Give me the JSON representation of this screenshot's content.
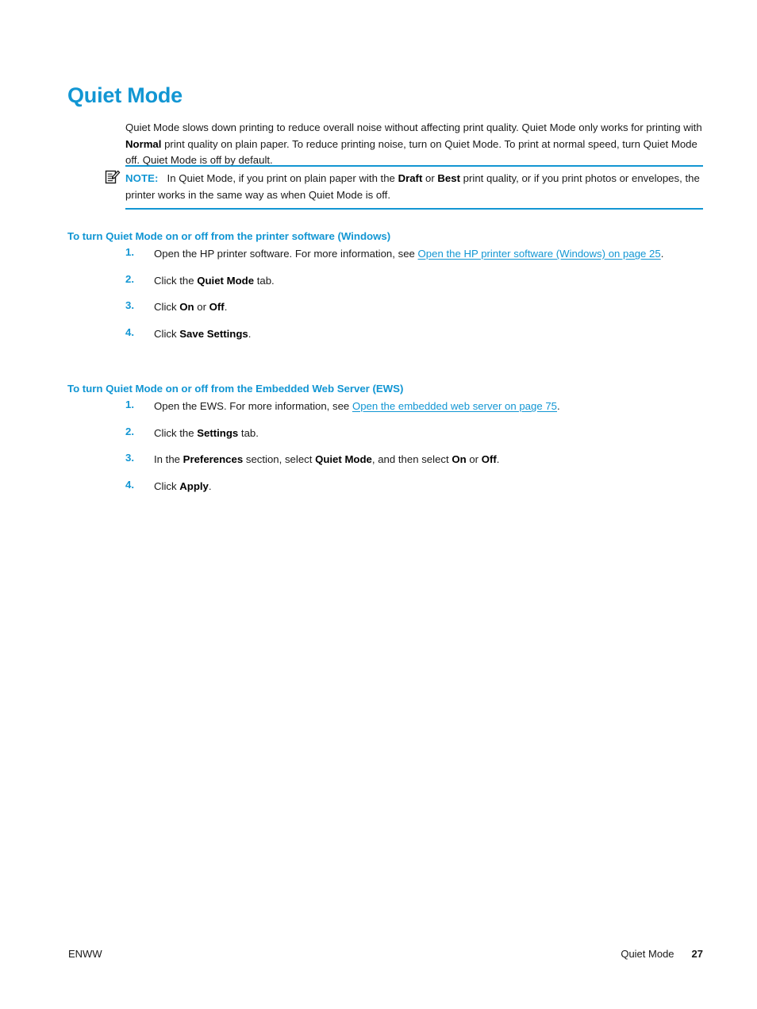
{
  "document": {
    "title": "Quiet Mode",
    "accent_color": "#1296d3",
    "body_color": "#1a1a1a"
  },
  "intro": {
    "part1": "Quiet Mode slows down printing to reduce overall noise without affecting print quality. Quiet Mode only works for printing with ",
    "bold1": "Normal",
    "part2": " print quality on plain paper. To reduce printing noise, turn on Quiet Mode. To print at normal speed, turn Quiet Mode off. Quiet Mode is off by default."
  },
  "note": {
    "icon": "note-pencil-icon",
    "label": "NOTE:",
    "part1": "In Quiet Mode, if you print on plain paper with the ",
    "bold1": "Draft",
    "part2": " or ",
    "bold2": "Best",
    "part3": " print quality, or if you print photos or envelopes, the printer works in the same way as when Quiet Mode is off."
  },
  "section_windows": {
    "heading": "To turn Quiet Mode on or off from the printer software (Windows)",
    "steps": [
      {
        "number": "1.",
        "part1": "Open the HP printer software. For more information, see ",
        "link": "Open the HP printer software (Windows) on page 25",
        "part2": "."
      },
      {
        "number": "2.",
        "part1": "Click the ",
        "bold1": "Quiet Mode",
        "part2": " tab."
      },
      {
        "number": "3.",
        "part1": "Click ",
        "bold1": "On",
        "part2": " or ",
        "bold2": "Off",
        "part3": "."
      },
      {
        "number": "4.",
        "part1": "Click ",
        "bold1": "Save Settings",
        "part2": "."
      }
    ]
  },
  "section_ews": {
    "heading": "To turn Quiet Mode on or off from the Embedded Web Server (EWS)",
    "steps": [
      {
        "number": "1.",
        "part1": "Open the EWS. For more information, see ",
        "link": "Open the embedded web server on page 75",
        "part2": "."
      },
      {
        "number": "2.",
        "part1": "Click the ",
        "bold1": "Settings",
        "part2": " tab."
      },
      {
        "number": "3.",
        "part1": "In the ",
        "bold1": "Preferences",
        "part2": " section, select ",
        "bold2": "Quiet Mode",
        "part3": ", and then select ",
        "bold3": "On",
        "part4": " or ",
        "bold4": "Off",
        "part5": "."
      },
      {
        "number": "4.",
        "part1": "Click ",
        "bold1": "Apply",
        "part2": "."
      }
    ]
  },
  "footer": {
    "left": "ENWW",
    "chapter": "Quiet Mode",
    "page_number": "27"
  }
}
